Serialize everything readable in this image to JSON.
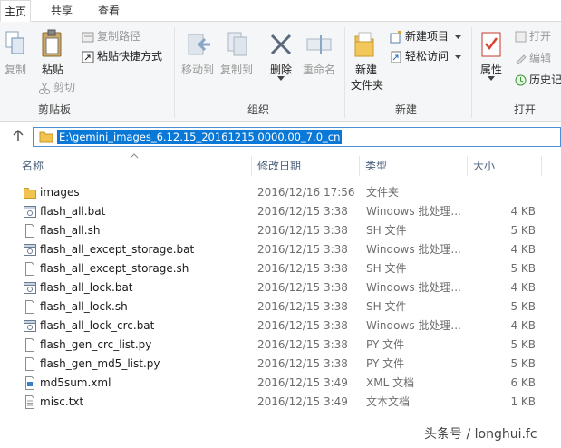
{
  "ribbon": {
    "tabs": [
      "主页",
      "共享",
      "查看"
    ],
    "clipboard": {
      "copy_label": "复制",
      "paste_label": "粘贴",
      "copy_path_label": "复制路径",
      "paste_shortcut_label": "粘贴快捷方式",
      "cut_label": "剪切",
      "group_label": "剪贴板"
    },
    "organize": {
      "move_to_label": "移动到",
      "copy_to_label": "复制到",
      "delete_label": "删除",
      "rename_label": "重命名",
      "group_label": "组织"
    },
    "new": {
      "new_folder_label_1": "新建",
      "new_folder_label_2": "文件夹",
      "new_item_label": "新建项目",
      "easy_access_label": "轻松访问",
      "group_label": "新建"
    },
    "open": {
      "properties_label": "属性",
      "open_label": "打开",
      "edit_label": "编辑",
      "history_label": "历史记",
      "group_label": "打开"
    }
  },
  "address": {
    "path": "E:\\gemini_images_6.12.15_20161215.0000.00_7.0_cn"
  },
  "columns": {
    "name": "名称",
    "date": "修改日期",
    "type": "类型",
    "size": "大小"
  },
  "files": [
    {
      "name": "images",
      "date": "2016/12/16 17:56",
      "type": "文件夹",
      "size": "",
      "icon": "folder-icon"
    },
    {
      "name": "flash_all.bat",
      "date": "2016/12/15 3:38",
      "type": "Windows 批处理...",
      "size": "4 KB",
      "icon": "batch-file-icon"
    },
    {
      "name": "flash_all.sh",
      "date": "2016/12/15 3:38",
      "type": "SH 文件",
      "size": "5 KB",
      "icon": "file-icon"
    },
    {
      "name": "flash_all_except_storage.bat",
      "date": "2016/12/15 3:38",
      "type": "Windows 批处理...",
      "size": "4 KB",
      "icon": "batch-file-icon"
    },
    {
      "name": "flash_all_except_storage.sh",
      "date": "2016/12/15 3:38",
      "type": "SH 文件",
      "size": "5 KB",
      "icon": "file-icon"
    },
    {
      "name": "flash_all_lock.bat",
      "date": "2016/12/15 3:38",
      "type": "Windows 批处理...",
      "size": "4 KB",
      "icon": "batch-file-icon"
    },
    {
      "name": "flash_all_lock.sh",
      "date": "2016/12/15 3:38",
      "type": "SH 文件",
      "size": "5 KB",
      "icon": "file-icon"
    },
    {
      "name": "flash_all_lock_crc.bat",
      "date": "2016/12/15 3:38",
      "type": "Windows 批处理...",
      "size": "4 KB",
      "icon": "batch-file-icon"
    },
    {
      "name": "flash_gen_crc_list.py",
      "date": "2016/12/15 3:38",
      "type": "PY 文件",
      "size": "5 KB",
      "icon": "file-icon"
    },
    {
      "name": "flash_gen_md5_list.py",
      "date": "2016/12/15 3:38",
      "type": "PY 文件",
      "size": "5 KB",
      "icon": "file-icon"
    },
    {
      "name": "md5sum.xml",
      "date": "2016/12/15 3:49",
      "type": "XML 文档",
      "size": "6 KB",
      "icon": "xml-file-icon"
    },
    {
      "name": "misc.txt",
      "date": "2016/12/15 3:49",
      "type": "文本文档",
      "size": "1 KB",
      "icon": "text-file-icon"
    }
  ],
  "watermark": {
    "text": "头条号 / longhui.fc"
  },
  "colors": {
    "selection": "#0a78d7",
    "folder": "#e8b64a",
    "header_text": "#4c607a"
  }
}
